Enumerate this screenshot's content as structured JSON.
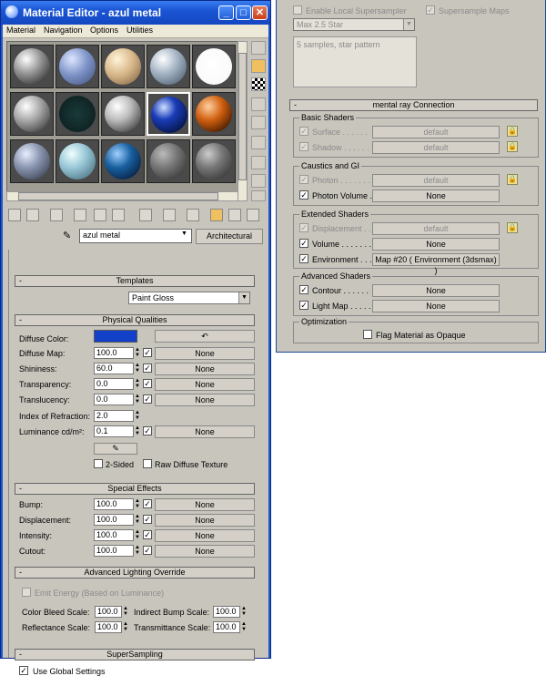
{
  "window": {
    "title": "Material Editor - azul metal"
  },
  "menu": [
    "Material",
    "Navigation",
    "Options",
    "Utilities"
  ],
  "material": {
    "name": "azul metal",
    "type_button": "Architectural"
  },
  "templates": {
    "header": "Templates",
    "value": "Paint Gloss"
  },
  "physical": {
    "header": "Physical Qualities",
    "diffuse_color_label": "Diffuse Color:",
    "diffuse_color": "#1240c8",
    "rows": [
      {
        "label": "Diffuse Map:",
        "value": "100.0",
        "map": "None"
      },
      {
        "label": "Shininess:",
        "value": "60.0",
        "map": "None"
      },
      {
        "label": "Transparency:",
        "value": "0.0",
        "map": "None"
      },
      {
        "label": "Translucency:",
        "value": "0.0",
        "map": "None"
      },
      {
        "label": "Index of Refraction:",
        "value": "2.0"
      },
      {
        "label": "Luminance cd/m²:",
        "value": "0.1",
        "map": "None"
      }
    ],
    "two_sided": "2-Sided",
    "raw_diffuse": "Raw Diffuse Texture"
  },
  "special": {
    "header": "Special Effects",
    "rows": [
      {
        "label": "Bump:",
        "value": "100.0",
        "map": "None"
      },
      {
        "label": "Displacement:",
        "value": "100.0",
        "map": "None"
      },
      {
        "label": "Intensity:",
        "value": "100.0",
        "map": "None"
      },
      {
        "label": "Cutout:",
        "value": "100.0",
        "map": "None"
      }
    ]
  },
  "advanced": {
    "header": "Advanced Lighting Override",
    "emit": "Emit Energy (Based on Luminance)",
    "color_bleed": {
      "label": "Color Bleed Scale:",
      "value": "100.0"
    },
    "indirect_bump": {
      "label": "Indirect Bump Scale:",
      "value": "100.0"
    },
    "reflectance": {
      "label": "Reflectance Scale:",
      "value": "100.0"
    },
    "transmittance": {
      "label": "Transmittance Scale:",
      "value": "100.0"
    }
  },
  "supersampling": {
    "header": "SuperSampling",
    "use_global": "Use Global Settings"
  },
  "right": {
    "enable_local": "Enable Local Supersampler",
    "supersample_maps": "Supersample Maps",
    "sampler": "Max 2.5 Star",
    "sampler_desc": "5 samples, star pattern",
    "mr_header": "mental ray Connection",
    "basic": {
      "title": "Basic Shaders",
      "rows": [
        {
          "label": "Surface . . . . . .",
          "value": "default"
        },
        {
          "label": "Shadow . . . . . .",
          "value": "default"
        }
      ]
    },
    "caustics": {
      "title": "Caustics and GI",
      "rows": [
        {
          "label": "Photon . . . . . . .",
          "value": "default"
        },
        {
          "label": "Photon Volume .",
          "value": "None"
        }
      ]
    },
    "extended": {
      "title": "Extended Shaders",
      "rows": [
        {
          "label": "Displacement . . .",
          "value": "default"
        },
        {
          "label": "Volume . . . . . . .",
          "value": "None"
        },
        {
          "label": "Environment . . .",
          "value": "Map #20  ( Environment (3dsmax) )"
        }
      ]
    },
    "advanced_shaders": {
      "title": "Advanced Shaders",
      "rows": [
        {
          "label": "Contour . . . . . .",
          "value": "None"
        },
        {
          "label": "Light Map . . . . .",
          "value": "None"
        }
      ]
    },
    "optimization": {
      "title": "Optimization",
      "flag": "Flag Material as Opaque"
    }
  },
  "colors": {
    "title_bar": "#1a55d4",
    "panel": "#c8c5bd",
    "lock": "#f0e090"
  }
}
